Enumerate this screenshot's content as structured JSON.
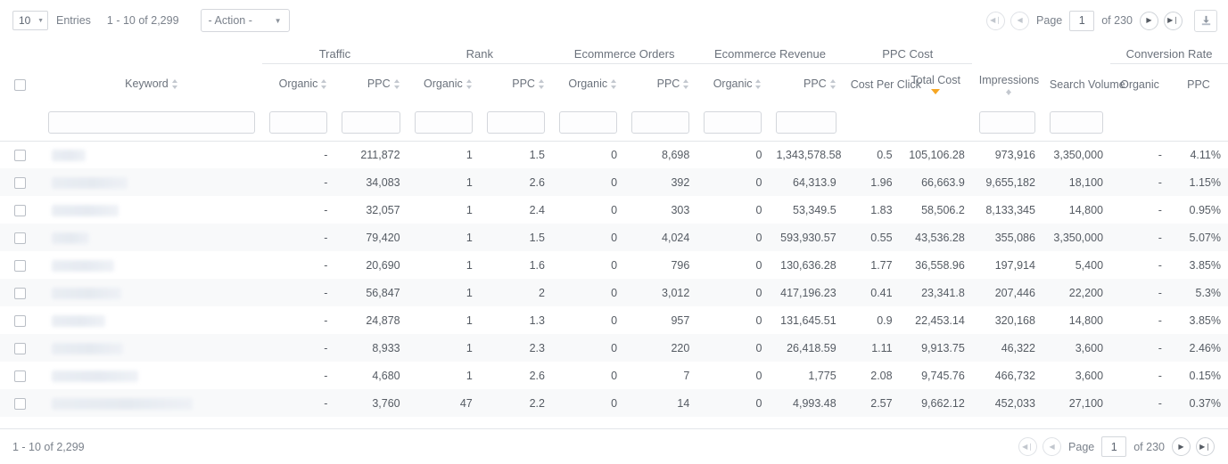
{
  "toolbar": {
    "entries_value": "10",
    "entries_label": "Entries",
    "range_text": "1 - 10 of 2,299",
    "action_label": "- Action -",
    "caret_glyph": "▼"
  },
  "pager_top": {
    "first_glyph": "◀❘",
    "prev_glyph": "◀",
    "page_label": "Page",
    "page_value": "1",
    "of_label": "of 230",
    "next_glyph": "▶",
    "last_glyph": "▶❘"
  },
  "pager_bottom": {
    "first_glyph": "◀❘",
    "prev_glyph": "◀",
    "page_label": "Page",
    "page_value": "1",
    "of_label": "of 230",
    "next_glyph": "▶",
    "last_glyph": "▶❘"
  },
  "footer": {
    "range_text": "1 - 10 of 2,299"
  },
  "table": {
    "groups": [
      {
        "label": "",
        "span": 2,
        "grouped": false
      },
      {
        "label": "Traffic",
        "span": 2,
        "grouped": true
      },
      {
        "label": "Rank",
        "span": 2,
        "grouped": true
      },
      {
        "label": "Ecommerce Orders",
        "span": 2,
        "grouped": true
      },
      {
        "label": "Ecommerce Revenue",
        "span": 2,
        "grouped": true
      },
      {
        "label": "PPC Cost",
        "span": 2,
        "grouped": true
      },
      {
        "label": "",
        "span": 2,
        "grouped": false
      },
      {
        "label": "Conversion Rate",
        "span": 2,
        "grouped": true
      }
    ],
    "columns": [
      {
        "key": "check",
        "label": "",
        "sortable": false,
        "align": "center",
        "filter": false
      },
      {
        "key": "keyword",
        "label": "Keyword",
        "sortable": true,
        "align": "center",
        "filter": true
      },
      {
        "key": "traffic_org",
        "label": "Organic",
        "sortable": true,
        "align": "right",
        "filter": true
      },
      {
        "key": "traffic_ppc",
        "label": "PPC",
        "sortable": true,
        "align": "right",
        "filter": true
      },
      {
        "key": "rank_org",
        "label": "Organic",
        "sortable": true,
        "align": "right",
        "filter": true
      },
      {
        "key": "rank_ppc",
        "label": "PPC",
        "sortable": true,
        "align": "right",
        "filter": true
      },
      {
        "key": "orders_org",
        "label": "Organic",
        "sortable": true,
        "align": "right",
        "filter": true
      },
      {
        "key": "orders_ppc",
        "label": "PPC",
        "sortable": true,
        "align": "right",
        "filter": true
      },
      {
        "key": "revenue_org",
        "label": "Organic",
        "sortable": true,
        "align": "right",
        "filter": true
      },
      {
        "key": "revenue_ppc",
        "label": "PPC",
        "sortable": true,
        "align": "right",
        "filter": true
      },
      {
        "key": "cpc",
        "label": "Cost Per Click",
        "sortable": false,
        "align": "center",
        "filter": false
      },
      {
        "key": "total_cost",
        "label": "Total Cost",
        "sortable": false,
        "align": "center",
        "filter": false,
        "sorted": "desc"
      },
      {
        "key": "impressions",
        "label": "Impressions",
        "sortable": true,
        "align": "center",
        "filter": true
      },
      {
        "key": "search_volume",
        "label": "Search Volume",
        "sortable": false,
        "align": "center",
        "filter": true
      },
      {
        "key": "cr_org",
        "label": "Organic",
        "sortable": false,
        "align": "center",
        "filter": false
      },
      {
        "key": "cr_ppc",
        "label": "PPC",
        "sortable": false,
        "align": "center",
        "filter": false
      }
    ],
    "filters": {
      "keyword": "",
      "traffic_org": "",
      "traffic_ppc": "",
      "rank_org": "",
      "rank_ppc": "",
      "orders_org": "",
      "orders_ppc": "",
      "revenue_org": "",
      "revenue_ppc": "",
      "impressions": "",
      "search_volume": ""
    },
    "rows": [
      {
        "keyword_redacted": true,
        "keyword_width": 38,
        "traffic_org": "-",
        "traffic_ppc": "211,872",
        "rank_org": "1",
        "rank_ppc": "1.5",
        "orders_org": "0",
        "orders_ppc": "8,698",
        "revenue_org": "0",
        "revenue_ppc": "1,343,578.58",
        "cpc": "0.5",
        "total_cost": "105,106.28",
        "impressions": "973,916",
        "search_volume": "3,350,000",
        "cr_org": "-",
        "cr_ppc": "4.11%"
      },
      {
        "keyword_redacted": true,
        "keyword_width": 85,
        "traffic_org": "-",
        "traffic_ppc": "34,083",
        "rank_org": "1",
        "rank_ppc": "2.6",
        "orders_org": "0",
        "orders_ppc": "392",
        "revenue_org": "0",
        "revenue_ppc": "64,313.9",
        "cpc": "1.96",
        "total_cost": "66,663.9",
        "impressions": "9,655,182",
        "search_volume": "18,100",
        "cr_org": "-",
        "cr_ppc": "1.15%"
      },
      {
        "keyword_redacted": true,
        "keyword_width": 75,
        "traffic_org": "-",
        "traffic_ppc": "32,057",
        "rank_org": "1",
        "rank_ppc": "2.4",
        "orders_org": "0",
        "orders_ppc": "303",
        "revenue_org": "0",
        "revenue_ppc": "53,349.5",
        "cpc": "1.83",
        "total_cost": "58,506.2",
        "impressions": "8,133,345",
        "search_volume": "14,800",
        "cr_org": "-",
        "cr_ppc": "0.95%"
      },
      {
        "keyword_redacted": true,
        "keyword_width": 42,
        "traffic_org": "-",
        "traffic_ppc": "79,420",
        "rank_org": "1",
        "rank_ppc": "1.5",
        "orders_org": "0",
        "orders_ppc": "4,024",
        "revenue_org": "0",
        "revenue_ppc": "593,930.57",
        "cpc": "0.55",
        "total_cost": "43,536.28",
        "impressions": "355,086",
        "search_volume": "3,350,000",
        "cr_org": "-",
        "cr_ppc": "5.07%"
      },
      {
        "keyword_redacted": true,
        "keyword_width": 70,
        "traffic_org": "-",
        "traffic_ppc": "20,690",
        "rank_org": "1",
        "rank_ppc": "1.6",
        "orders_org": "0",
        "orders_ppc": "796",
        "revenue_org": "0",
        "revenue_ppc": "130,636.28",
        "cpc": "1.77",
        "total_cost": "36,558.96",
        "impressions": "197,914",
        "search_volume": "5,400",
        "cr_org": "-",
        "cr_ppc": "3.85%"
      },
      {
        "keyword_redacted": true,
        "keyword_width": 78,
        "traffic_org": "-",
        "traffic_ppc": "56,847",
        "rank_org": "1",
        "rank_ppc": "2",
        "orders_org": "0",
        "orders_ppc": "3,012",
        "revenue_org": "0",
        "revenue_ppc": "417,196.23",
        "cpc": "0.41",
        "total_cost": "23,341.8",
        "impressions": "207,446",
        "search_volume": "22,200",
        "cr_org": "-",
        "cr_ppc": "5.3%"
      },
      {
        "keyword_redacted": true,
        "keyword_width": 60,
        "traffic_org": "-",
        "traffic_ppc": "24,878",
        "rank_org": "1",
        "rank_ppc": "1.3",
        "orders_org": "0",
        "orders_ppc": "957",
        "revenue_org": "0",
        "revenue_ppc": "131,645.51",
        "cpc": "0.9",
        "total_cost": "22,453.14",
        "impressions": "320,168",
        "search_volume": "14,800",
        "cr_org": "-",
        "cr_ppc": "3.85%"
      },
      {
        "keyword_redacted": true,
        "keyword_width": 80,
        "traffic_org": "-",
        "traffic_ppc": "8,933",
        "rank_org": "1",
        "rank_ppc": "2.3",
        "orders_org": "0",
        "orders_ppc": "220",
        "revenue_org": "0",
        "revenue_ppc": "26,418.59",
        "cpc": "1.11",
        "total_cost": "9,913.75",
        "impressions": "46,322",
        "search_volume": "3,600",
        "cr_org": "-",
        "cr_ppc": "2.46%"
      },
      {
        "keyword_redacted": true,
        "keyword_width": 97,
        "traffic_org": "-",
        "traffic_ppc": "4,680",
        "rank_org": "1",
        "rank_ppc": "2.6",
        "orders_org": "0",
        "orders_ppc": "7",
        "revenue_org": "0",
        "revenue_ppc": "1,775",
        "cpc": "2.08",
        "total_cost": "9,745.76",
        "impressions": "466,732",
        "search_volume": "3,600",
        "cr_org": "-",
        "cr_ppc": "0.15%"
      },
      {
        "keyword_redacted": true,
        "keyword_width": 158,
        "traffic_org": "-",
        "traffic_ppc": "3,760",
        "rank_org": "47",
        "rank_ppc": "2.2",
        "orders_org": "0",
        "orders_ppc": "14",
        "revenue_org": "0",
        "revenue_ppc": "4,993.48",
        "cpc": "2.57",
        "total_cost": "9,662.12",
        "impressions": "452,033",
        "search_volume": "27,100",
        "cr_org": "-",
        "cr_ppc": "0.37%"
      }
    ]
  },
  "colors": {
    "accent_sort": "#f6a623",
    "text": "#555b63",
    "muted": "#7a818b",
    "border": "#e3e6e9",
    "zebra": "#f8f9fa"
  }
}
